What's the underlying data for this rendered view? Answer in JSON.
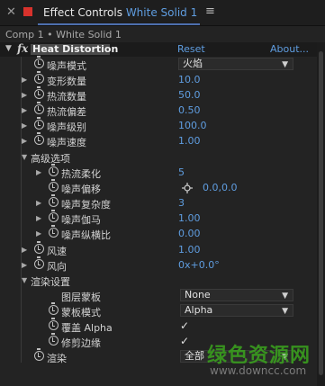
{
  "titlebar": {
    "panel_title": "Effect Controls",
    "layer_name": "White Solid 1",
    "menu_icon": "hamburger-menu-icon",
    "close_icon": "close-icon"
  },
  "breadcrumb": "Comp 1 • White Solid 1",
  "effect": {
    "name": "Heat Distortion",
    "reset_label": "Reset",
    "about_label": "About...",
    "fx_label": "fx"
  },
  "params": {
    "noise_mode": {
      "label": "噪声模式",
      "value": "火焰"
    },
    "deform_amount": {
      "label": "变形数量",
      "value": "10.0"
    },
    "heat_amount": {
      "label": "热流数量",
      "value": "50.0"
    },
    "heat_bias": {
      "label": "热流偏差",
      "value": "0.50"
    },
    "noise_level": {
      "label": "噪声级别",
      "value": "100.0"
    },
    "noise_speed": {
      "label": "噪声速度",
      "value": "1.00"
    },
    "advanced_group": {
      "label": "高级选项"
    },
    "heat_soften": {
      "label": "热流柔化",
      "value": "5"
    },
    "noise_offset": {
      "label": "噪声偏移",
      "value": "0.0,0.0"
    },
    "noise_complexity": {
      "label": "噪声复杂度",
      "value": "3"
    },
    "noise_gamma": {
      "label": "噪声伽马",
      "value": "1.00"
    },
    "noise_aspect": {
      "label": "噪声纵横比",
      "value": "0.00"
    },
    "wind_speed": {
      "label": "风速",
      "value": "1.00"
    },
    "wind_direction": {
      "label": "风向",
      "value": "0x+0.0°"
    },
    "render_group": {
      "label": "渲染设置"
    },
    "layer_matte": {
      "label": "图层蒙板",
      "value": "None"
    },
    "matte_mode": {
      "label": "蒙板模式",
      "value": "Alpha"
    },
    "overlay_alpha": {
      "label": "覆盖 Alpha",
      "checked": "✓"
    },
    "trim_edges": {
      "label": "修剪边缘",
      "checked": "✓"
    },
    "render": {
      "label": "渲染",
      "value": "全部"
    }
  },
  "watermark": {
    "line1": "绿色资源网",
    "line2": "www.downcc.com"
  },
  "colors": {
    "accent": "#5f9de0",
    "background": "#232323",
    "close_red": "#d8322c"
  }
}
